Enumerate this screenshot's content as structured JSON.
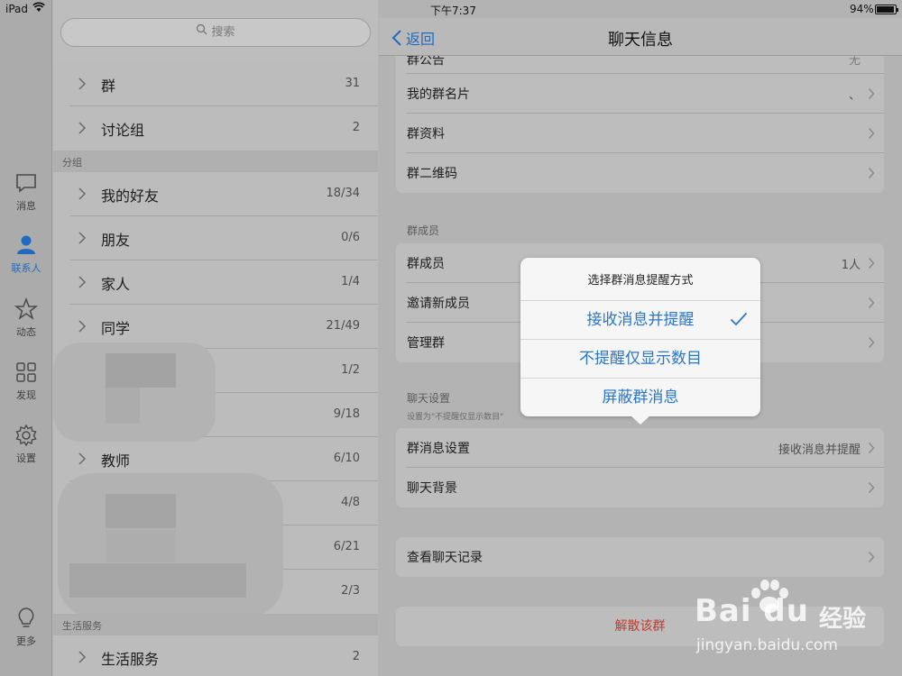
{
  "status_bar": {
    "carrier": "iPad",
    "time": "下午7:37",
    "battery_percent": "94%",
    "battery_level": 0.94
  },
  "tab_rail": {
    "items": [
      {
        "label": "消息",
        "icon": "chat-bubble-icon",
        "active": false
      },
      {
        "label": "联系人",
        "icon": "person-icon",
        "active": true
      },
      {
        "label": "动态",
        "icon": "star-icon",
        "active": false
      },
      {
        "label": "发现",
        "icon": "grid-icon",
        "active": false
      },
      {
        "label": "设置",
        "icon": "gear-icon",
        "active": false
      },
      {
        "label": "更多",
        "icon": "lightbulb-icon",
        "active": false
      }
    ]
  },
  "contacts": {
    "search_placeholder": "搜索",
    "top_rows": [
      {
        "label": "群",
        "count": "31"
      },
      {
        "label": "讨论组",
        "count": "2"
      }
    ],
    "section_groups": "分组",
    "group_rows": [
      {
        "label": "我的好友",
        "count": "18/34"
      },
      {
        "label": "朋友",
        "count": "0/6"
      },
      {
        "label": "家人",
        "count": "1/4"
      },
      {
        "label": "同学",
        "count": "21/49"
      },
      {
        "label": "",
        "count": "1/2"
      },
      {
        "label": "",
        "count": "9/18"
      },
      {
        "label": "教师",
        "count": "6/10"
      },
      {
        "label": "",
        "count": "4/8"
      },
      {
        "label": "",
        "count": "6/21"
      },
      {
        "label": "",
        "count": "2/3"
      }
    ],
    "section_services": "生活服务",
    "service_rows": [
      {
        "label": "生活服务",
        "count": "2"
      }
    ]
  },
  "detail": {
    "back_label": "返回",
    "title": "聊天信息",
    "group_info": [
      {
        "label": "群公告",
        "value": "无"
      },
      {
        "label": "我的群名片",
        "value": "、"
      },
      {
        "label": "群资料",
        "value": ""
      },
      {
        "label": "群二维码",
        "value": ""
      }
    ],
    "members_header": "群成员",
    "members": [
      {
        "label": "群成员",
        "value": "1人"
      },
      {
        "label": "邀请新成员",
        "value": ""
      },
      {
        "label": "管理群",
        "value": ""
      }
    ],
    "chat_settings_header": "聊天设置",
    "chat_settings_note": "设置为\"不提醒仅显示数目\"",
    "chat_settings": [
      {
        "label": "群消息设置",
        "value": "接收消息并提醒"
      },
      {
        "label": "聊天背景",
        "value": ""
      }
    ],
    "history": [
      {
        "label": "查看聊天记录",
        "value": ""
      }
    ],
    "dissolve_label": "解散该群"
  },
  "popover": {
    "title": "选择群消息提醒方式",
    "options": [
      {
        "label": "接收消息并提醒",
        "selected": true
      },
      {
        "label": "不提醒仅显示数目",
        "selected": false
      },
      {
        "label": "屏蔽群消息",
        "selected": false
      }
    ]
  },
  "watermark": {
    "logo": "Bai du",
    "cn": "经验",
    "url": "jingyan.baidu.com"
  },
  "colors": {
    "accent": "#1f6bc2",
    "danger": "#c23b2f",
    "popover_option": "#2a76c9"
  }
}
